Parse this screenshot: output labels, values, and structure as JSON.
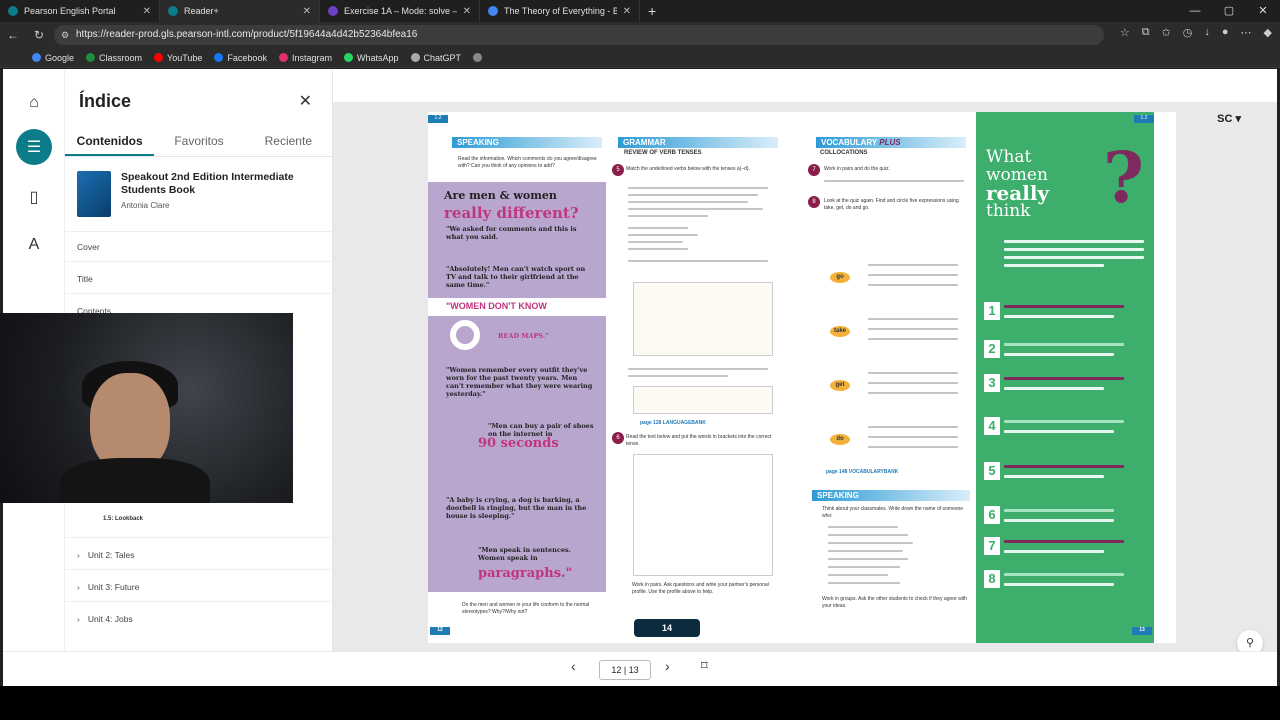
{
  "browser": {
    "tabs": [
      {
        "title": "Pearson English Portal",
        "color": "#0c7c88",
        "active": false
      },
      {
        "title": "Reader+",
        "color": "#0c7c88",
        "active": true
      },
      {
        "title": "Exercise 1A – Mode: solve – Unit",
        "color": "#6c3fc4",
        "active": false
      },
      {
        "title": "The Theory of Everything - Buscar",
        "color": "#4285f4",
        "active": false
      }
    ],
    "url": "https://reader-prod.gls.pearson-intl.com/product/5f19644a4d42b52364bfea16",
    "bookmarks": [
      {
        "label": "Google",
        "color": "#4285f4"
      },
      {
        "label": "Classroom",
        "color": "#1e8e3e"
      },
      {
        "label": "YouTube",
        "color": "#ff0000"
      },
      {
        "label": "Facebook",
        "color": "#1877f2"
      },
      {
        "label": "Instagram",
        "color": "#e1306c"
      },
      {
        "label": "WhatsApp",
        "color": "#25d366"
      },
      {
        "label": "ChatGPT",
        "color": "#aaaaaa"
      }
    ]
  },
  "panel": {
    "title": "Índice",
    "tabs": [
      "Contenidos",
      "Favoritos",
      "Reciente"
    ],
    "book_title": "Speakout 2nd Edition Intermediate Students Book",
    "book_author": "Antonia Clare",
    "toc": [
      "Cover",
      "Title",
      "Contents"
    ],
    "toc_sub": "1.5: Lookback",
    "units": [
      "Unit 2: Tales",
      "Unit 3: Future",
      "Unit 4: Jobs"
    ]
  },
  "viewer": {
    "user": "SC",
    "page_indicator": "12 | 13",
    "page_badge": "14",
    "left_page_tab": "1.2",
    "right_page_tab": "1.2",
    "left_footer_num": "12",
    "right_footer_num": "13"
  },
  "left_page": {
    "speaking_head": "SPEAKING",
    "grammar_head": "GRAMMAR",
    "grammar_sub": "REVIEW OF VERB TENSES",
    "poster_line1": "Are men & women",
    "poster_line2": "really different?",
    "poster_band": "\"WOMEN DON'T KNOW",
    "poster_read_maps": "READ MAPS.\"",
    "poster_90": "90 seconds",
    "poster_para": "paragraphs.\"",
    "q4": "Read the information. Which comments do you agree/disagree with? Can you think of any opinions to add?",
    "q_b": "Do the men and women in your life conform to the normal stereotypes? Why?/Why not?",
    "q5": "Match the underlined verbs below with the tenses a)–d).",
    "q6": "Read the text below and put the words in brackets into the correct tense.",
    "lang_bank": "page 128 LANGUAGEBANK",
    "q6b": "Work in pairs. Ask questions and write your partner's personal profile. Use the profile above to help."
  },
  "right_page": {
    "vocab_head": "VOCABULARY",
    "vocab_plus": "PLUS",
    "collocations": "COLLOCATIONS",
    "q7": "Work in pairs and do the quiz.",
    "q8": "Look at the quiz again. Find and circle five expressions using take, get, do and go.",
    "verbs": [
      "go",
      "take",
      "get",
      "do"
    ],
    "vocab_bank": "page 148 VOCABULARYBANK",
    "speaking_head": "SPEAKING",
    "q9": "Think about your classmates. Write down the name of someone who:",
    "q9b": "Work in groups. Ask the other students to check if they agree with your ideas.",
    "feature_line1": "What",
    "feature_line2": "women",
    "feature_line3": "really",
    "feature_line4": "think",
    "quiz_nums": [
      "1",
      "2",
      "3",
      "4",
      "5",
      "6",
      "7",
      "8"
    ]
  }
}
